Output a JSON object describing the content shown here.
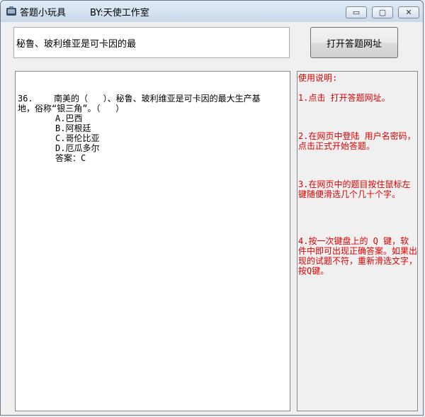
{
  "window": {
    "title": "答题小玩具",
    "by": "BY:天使工作室",
    "minimize_glyph": "▭",
    "maximize_glyph": "▢",
    "close_glyph": "✕"
  },
  "search": {
    "value": "秘鲁、玻利维亚是可卡因的最"
  },
  "buttons": {
    "open_label": "打开答题网址"
  },
  "question": {
    "number": "36.",
    "text": "南美的（   ）、秘鲁、玻利维亚是可卡因的最大生产基",
    "text_line2": "地，俗称“银三角”。（   ）",
    "options": [
      "A.巴西",
      "B.阿根廷",
      "C.哥伦比亚",
      "D.厄瓜多尔"
    ],
    "answer": "答案：C"
  },
  "help": {
    "title": "使用说明:",
    "steps": [
      "1.点击 打开答题网址。",
      "2.在网页中登陆 用户名密码，点击正式开始答题。",
      "3.在网页中的题目按住鼠标左键随便滑选几个几十个字。",
      "4.按一次键盘上的 Q 键，软件中即可出现正确答案。如果出现的试题不符，重新滑选文字，按Q键。"
    ]
  },
  "colors": {
    "help_text": "#e00000"
  }
}
